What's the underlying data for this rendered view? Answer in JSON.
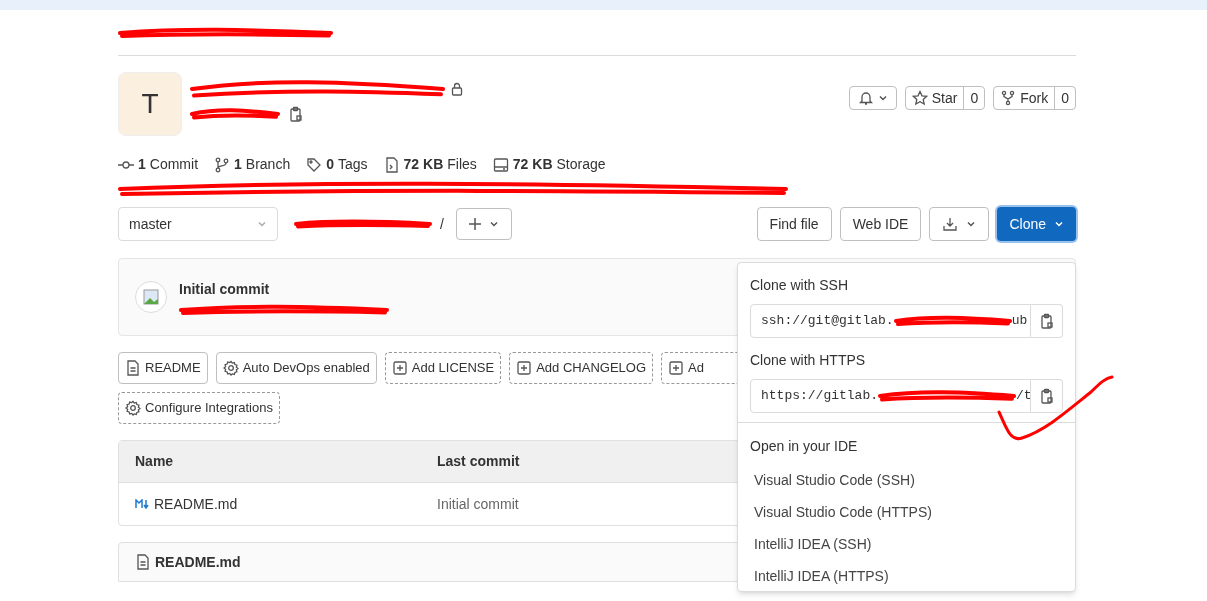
{
  "project": {
    "avatar_letter": "T"
  },
  "header_actions": {
    "star": {
      "label": "Star",
      "count": "0"
    },
    "fork": {
      "label": "Fork",
      "count": "0"
    }
  },
  "stats": [
    {
      "kind": "commit",
      "count": "1",
      "label": "Commit"
    },
    {
      "kind": "branch",
      "count": "1",
      "label": "Branch"
    },
    {
      "kind": "tag",
      "count": "0",
      "label": "Tags"
    },
    {
      "kind": "files",
      "count": "72 KB",
      "label": "Files"
    },
    {
      "kind": "storage",
      "count": "72 KB",
      "label": "Storage"
    }
  ],
  "branch": {
    "value": "master",
    "separator": "/"
  },
  "toolbar": {
    "find_file": "Find file",
    "web_ide": "Web IDE",
    "clone": "Clone"
  },
  "commit": {
    "title": "Initial commit"
  },
  "quick_actions": [
    {
      "label": "README",
      "kind": "readme"
    },
    {
      "label": "Auto DevOps enabled",
      "kind": "devops"
    },
    {
      "label": "Add LICENSE",
      "kind": "add"
    },
    {
      "label": "Add CHANGELOG",
      "kind": "add"
    },
    {
      "label": "Ad",
      "kind": "add"
    },
    {
      "label": "Configure Integrations",
      "kind": "integrations"
    }
  ],
  "table": {
    "columns": [
      "Name",
      "Last commit"
    ],
    "rows": [
      {
        "name": "README.md",
        "last_commit": "Initial commit"
      }
    ]
  },
  "readme": {
    "title": "README.md"
  },
  "clone_menu": {
    "ssh_label": "Clone with SSH",
    "ssh_start": "ssh://git@gitlab.",
    "ssh_end": "ub",
    "https_label": "Clone with HTTPS",
    "https_start": "https://gitlab.",
    "https_end": "/t",
    "ide_heading": "Open in your IDE",
    "ide_items": [
      "Visual Studio Code (SSH)",
      "Visual Studio Code (HTTPS)",
      "IntelliJ IDEA (SSH)",
      "IntelliJ IDEA (HTTPS)"
    ]
  }
}
